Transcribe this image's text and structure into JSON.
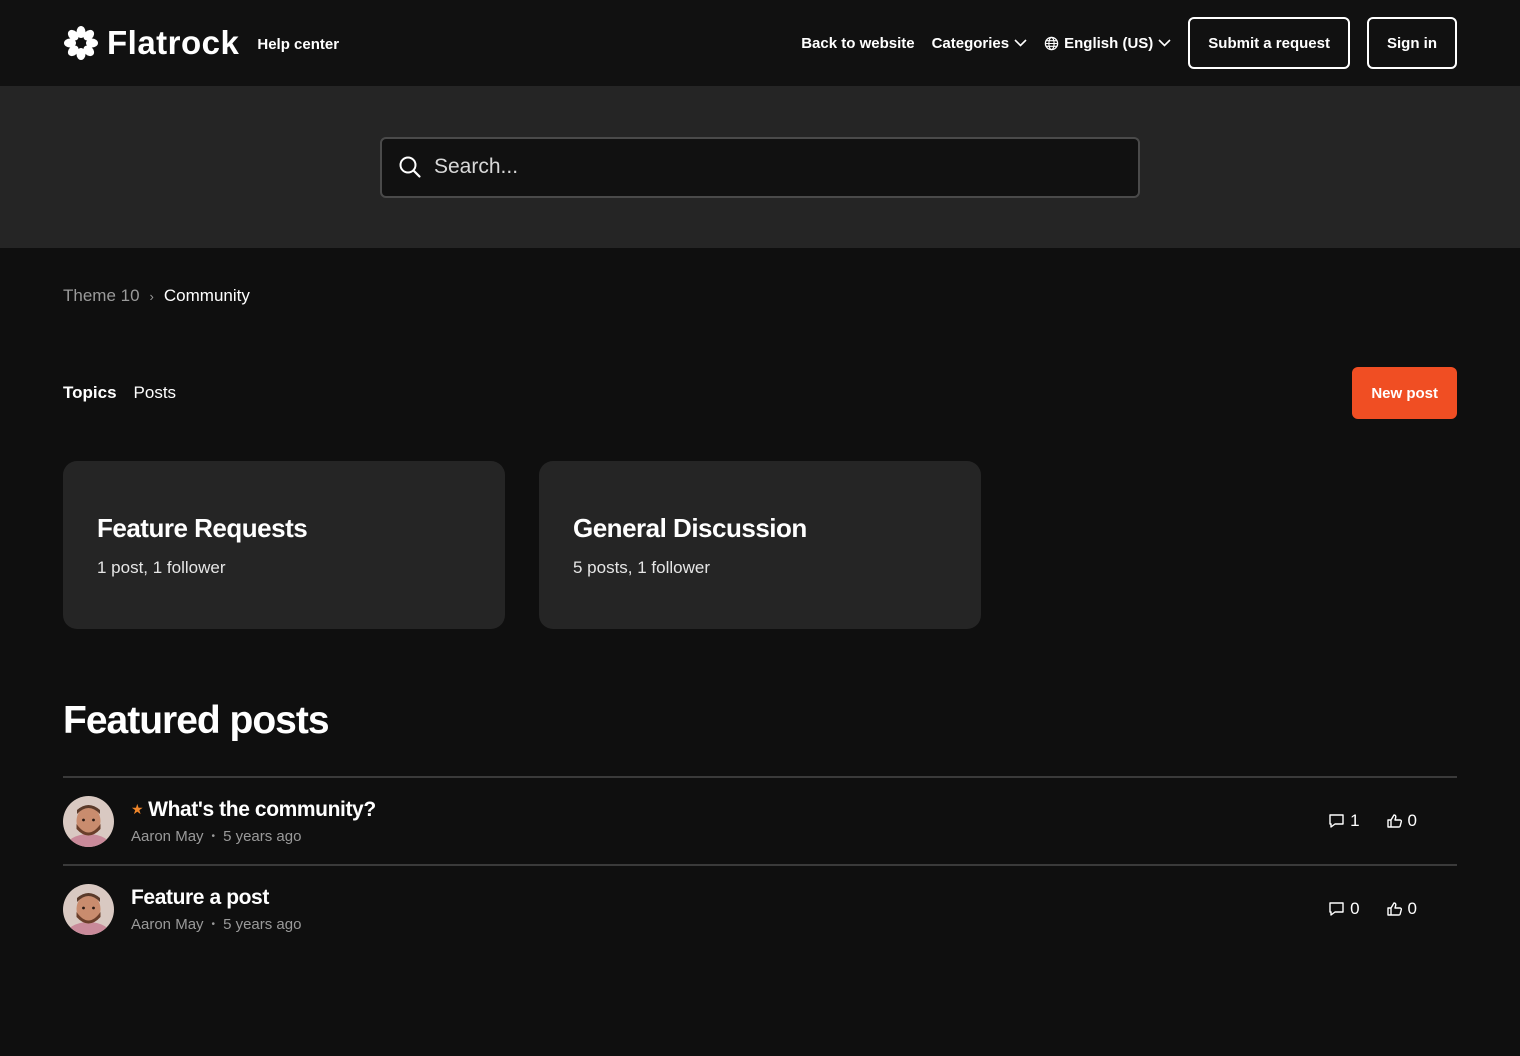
{
  "header": {
    "logo_text": "Flatrock",
    "subtitle": "Help center",
    "nav": {
      "back_label": "Back to website",
      "categories_label": "Categories",
      "language_label": "English (US)",
      "submit_label": "Submit a request",
      "signin_label": "Sign in"
    }
  },
  "search": {
    "placeholder": "Search..."
  },
  "breadcrumb": {
    "items": [
      "Theme 10",
      "Community"
    ],
    "separator": "›"
  },
  "tabs": {
    "topics_label": "Topics",
    "posts_label": "Posts"
  },
  "new_post_label": "New post",
  "topics": [
    {
      "title": "Feature Requests",
      "meta": "1 post, 1 follower"
    },
    {
      "title": "General Discussion",
      "meta": "5 posts, 1 follower"
    }
  ],
  "featured": {
    "title": "Featured posts",
    "posts": [
      {
        "title": "What's the community?",
        "author": "Aaron May",
        "time": "5 years ago",
        "comments": "1",
        "votes": "0",
        "pinned": true
      },
      {
        "title": "Feature a post",
        "author": "Aaron May",
        "time": "5 years ago",
        "comments": "0",
        "votes": "0",
        "pinned": false
      }
    ]
  },
  "colors": {
    "accent": "#f04e23",
    "star": "#f0862a",
    "bg": "#0f0f0f",
    "panel": "#252525"
  }
}
